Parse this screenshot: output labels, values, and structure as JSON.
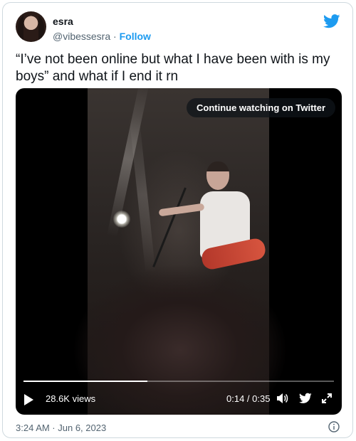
{
  "author": {
    "name": "esra",
    "handle": "@vibessesra",
    "separator": " · ",
    "follow_label": "Follow"
  },
  "tweet": {
    "text": "“I’ve not been online but what I have been with is my boys” and what if I end it rn",
    "timestamp": "3:24 AM · Jun 6, 2023"
  },
  "video": {
    "continue_label": "Continue watching on Twitter",
    "views": "28.6K views",
    "time": "0:14 / 0:35",
    "progress": 0.4
  },
  "colors": {
    "accent": "#1d9bf0",
    "text": "#0f1419",
    "secondary": "#536471"
  },
  "icons": [
    "twitter-bird-icon",
    "play-icon",
    "volume-icon",
    "twitter-bird-icon",
    "fullscreen-icon",
    "info-icon"
  ]
}
